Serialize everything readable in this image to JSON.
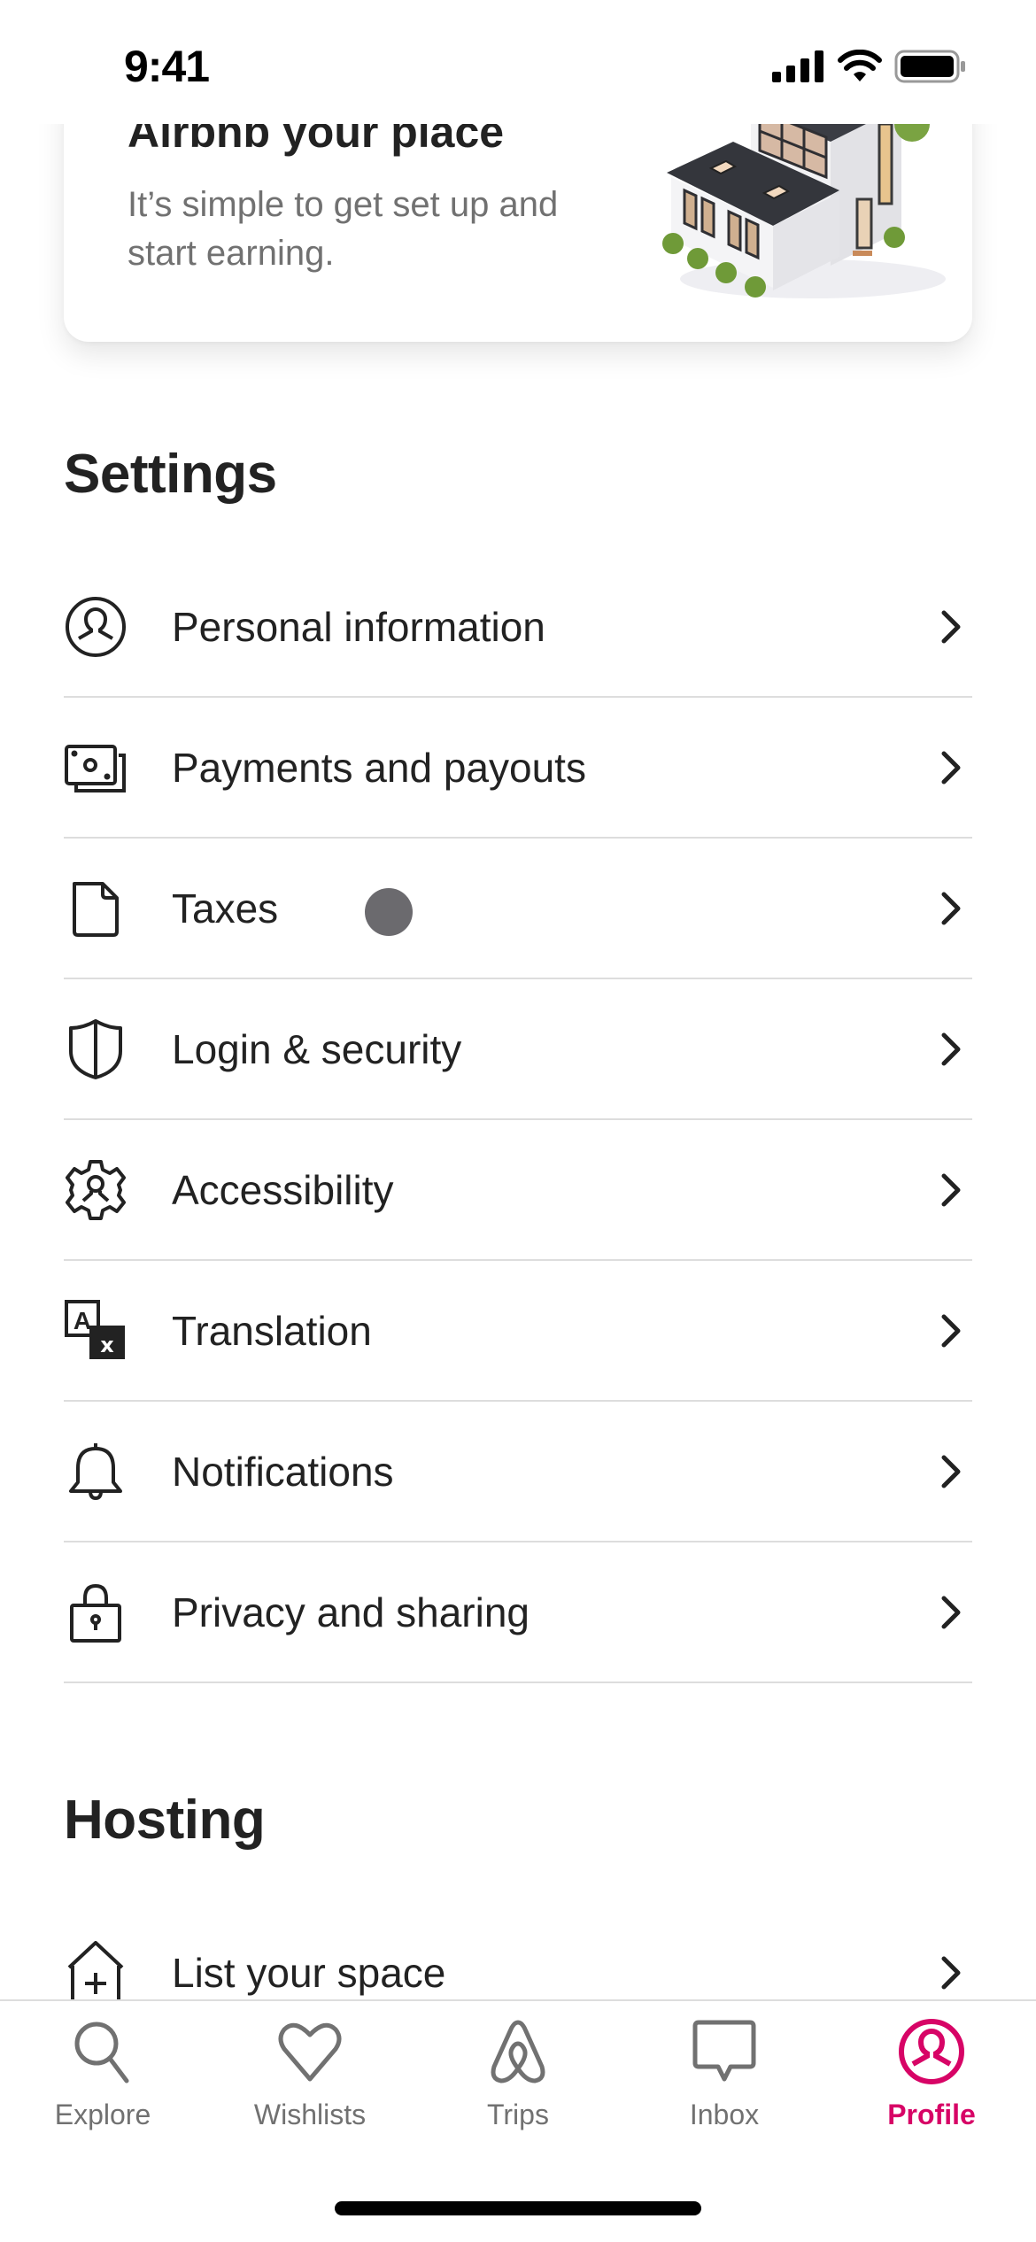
{
  "status_bar": {
    "time": "9:41",
    "icons": [
      "cellular-signal-icon",
      "wifi-icon",
      "battery-icon"
    ]
  },
  "host_card": {
    "title": "Airbnb your place",
    "subtitle": "It’s simple to get set up and start earning.",
    "image": "house-illustration"
  },
  "settings": {
    "title": "Settings",
    "items": [
      {
        "label": "Personal information",
        "icon": "user-circle-icon"
      },
      {
        "label": "Payments and payouts",
        "icon": "money-icon"
      },
      {
        "label": "Taxes",
        "icon": "document-icon"
      },
      {
        "label": "Login & security",
        "icon": "shield-icon"
      },
      {
        "label": "Accessibility",
        "icon": "accessibility-gear-icon"
      },
      {
        "label": "Translation",
        "icon": "translate-icon"
      },
      {
        "label": "Notifications",
        "icon": "bell-icon"
      },
      {
        "label": "Privacy and sharing",
        "icon": "lock-icon"
      }
    ]
  },
  "hosting": {
    "title": "Hosting",
    "items": [
      {
        "label": "List your space",
        "icon": "house-plus-icon"
      }
    ]
  },
  "tab_bar": {
    "active": "Profile",
    "active_color": "#D70466",
    "inactive_color": "#717171",
    "tabs": [
      {
        "label": "Explore",
        "icon": "search-icon"
      },
      {
        "label": "Wishlists",
        "icon": "heart-icon"
      },
      {
        "label": "Trips",
        "icon": "airbnb-logo-icon"
      },
      {
        "label": "Inbox",
        "icon": "message-icon"
      },
      {
        "label": "Profile",
        "icon": "user-circle-icon"
      }
    ]
  }
}
